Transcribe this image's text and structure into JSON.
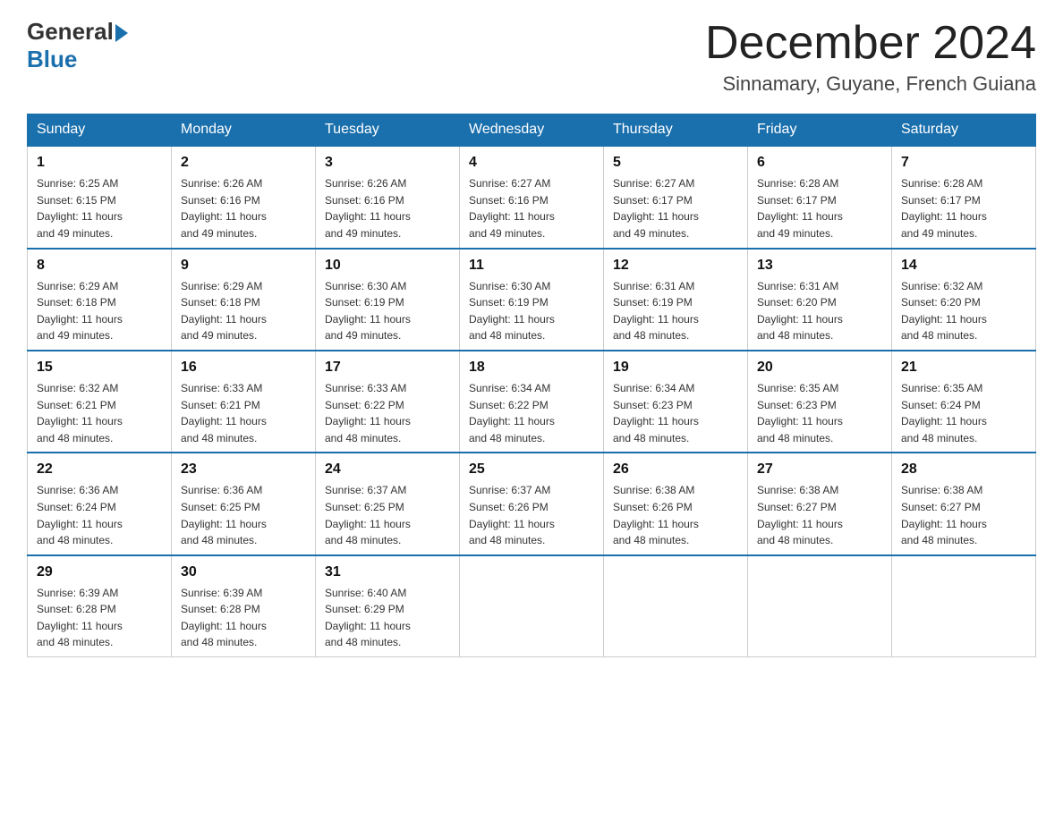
{
  "logo": {
    "general": "General",
    "blue": "Blue"
  },
  "header": {
    "month": "December 2024",
    "location": "Sinnamary, Guyane, French Guiana"
  },
  "weekdays": [
    "Sunday",
    "Monday",
    "Tuesday",
    "Wednesday",
    "Thursday",
    "Friday",
    "Saturday"
  ],
  "weeks": [
    [
      {
        "day": "1",
        "sunrise": "6:25 AM",
        "sunset": "6:15 PM",
        "daylight": "11 hours and 49 minutes."
      },
      {
        "day": "2",
        "sunrise": "6:26 AM",
        "sunset": "6:16 PM",
        "daylight": "11 hours and 49 minutes."
      },
      {
        "day": "3",
        "sunrise": "6:26 AM",
        "sunset": "6:16 PM",
        "daylight": "11 hours and 49 minutes."
      },
      {
        "day": "4",
        "sunrise": "6:27 AM",
        "sunset": "6:16 PM",
        "daylight": "11 hours and 49 minutes."
      },
      {
        "day": "5",
        "sunrise": "6:27 AM",
        "sunset": "6:17 PM",
        "daylight": "11 hours and 49 minutes."
      },
      {
        "day": "6",
        "sunrise": "6:28 AM",
        "sunset": "6:17 PM",
        "daylight": "11 hours and 49 minutes."
      },
      {
        "day": "7",
        "sunrise": "6:28 AM",
        "sunset": "6:17 PM",
        "daylight": "11 hours and 49 minutes."
      }
    ],
    [
      {
        "day": "8",
        "sunrise": "6:29 AM",
        "sunset": "6:18 PM",
        "daylight": "11 hours and 49 minutes."
      },
      {
        "day": "9",
        "sunrise": "6:29 AM",
        "sunset": "6:18 PM",
        "daylight": "11 hours and 49 minutes."
      },
      {
        "day": "10",
        "sunrise": "6:30 AM",
        "sunset": "6:19 PM",
        "daylight": "11 hours and 49 minutes."
      },
      {
        "day": "11",
        "sunrise": "6:30 AM",
        "sunset": "6:19 PM",
        "daylight": "11 hours and 48 minutes."
      },
      {
        "day": "12",
        "sunrise": "6:31 AM",
        "sunset": "6:19 PM",
        "daylight": "11 hours and 48 minutes."
      },
      {
        "day": "13",
        "sunrise": "6:31 AM",
        "sunset": "6:20 PM",
        "daylight": "11 hours and 48 minutes."
      },
      {
        "day": "14",
        "sunrise": "6:32 AM",
        "sunset": "6:20 PM",
        "daylight": "11 hours and 48 minutes."
      }
    ],
    [
      {
        "day": "15",
        "sunrise": "6:32 AM",
        "sunset": "6:21 PM",
        "daylight": "11 hours and 48 minutes."
      },
      {
        "day": "16",
        "sunrise": "6:33 AM",
        "sunset": "6:21 PM",
        "daylight": "11 hours and 48 minutes."
      },
      {
        "day": "17",
        "sunrise": "6:33 AM",
        "sunset": "6:22 PM",
        "daylight": "11 hours and 48 minutes."
      },
      {
        "day": "18",
        "sunrise": "6:34 AM",
        "sunset": "6:22 PM",
        "daylight": "11 hours and 48 minutes."
      },
      {
        "day": "19",
        "sunrise": "6:34 AM",
        "sunset": "6:23 PM",
        "daylight": "11 hours and 48 minutes."
      },
      {
        "day": "20",
        "sunrise": "6:35 AM",
        "sunset": "6:23 PM",
        "daylight": "11 hours and 48 minutes."
      },
      {
        "day": "21",
        "sunrise": "6:35 AM",
        "sunset": "6:24 PM",
        "daylight": "11 hours and 48 minutes."
      }
    ],
    [
      {
        "day": "22",
        "sunrise": "6:36 AM",
        "sunset": "6:24 PM",
        "daylight": "11 hours and 48 minutes."
      },
      {
        "day": "23",
        "sunrise": "6:36 AM",
        "sunset": "6:25 PM",
        "daylight": "11 hours and 48 minutes."
      },
      {
        "day": "24",
        "sunrise": "6:37 AM",
        "sunset": "6:25 PM",
        "daylight": "11 hours and 48 minutes."
      },
      {
        "day": "25",
        "sunrise": "6:37 AM",
        "sunset": "6:26 PM",
        "daylight": "11 hours and 48 minutes."
      },
      {
        "day": "26",
        "sunrise": "6:38 AM",
        "sunset": "6:26 PM",
        "daylight": "11 hours and 48 minutes."
      },
      {
        "day": "27",
        "sunrise": "6:38 AM",
        "sunset": "6:27 PM",
        "daylight": "11 hours and 48 minutes."
      },
      {
        "day": "28",
        "sunrise": "6:38 AM",
        "sunset": "6:27 PM",
        "daylight": "11 hours and 48 minutes."
      }
    ],
    [
      {
        "day": "29",
        "sunrise": "6:39 AM",
        "sunset": "6:28 PM",
        "daylight": "11 hours and 48 minutes."
      },
      {
        "day": "30",
        "sunrise": "6:39 AM",
        "sunset": "6:28 PM",
        "daylight": "11 hours and 48 minutes."
      },
      {
        "day": "31",
        "sunrise": "6:40 AM",
        "sunset": "6:29 PM",
        "daylight": "11 hours and 48 minutes."
      },
      null,
      null,
      null,
      null
    ]
  ],
  "labels": {
    "sunrise": "Sunrise:",
    "sunset": "Sunset:",
    "daylight": "Daylight:"
  }
}
